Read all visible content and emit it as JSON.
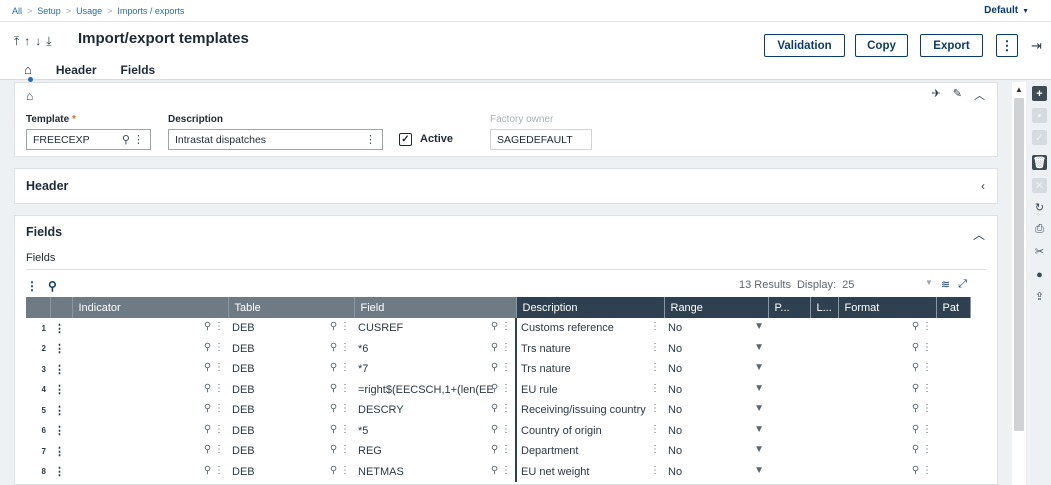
{
  "breadcrumb": [
    "All",
    "Setup",
    "Usage",
    "Imports / exports"
  ],
  "profile": "Default",
  "title": "Import/export templates",
  "nav_arrows": "⤒↑↓⤓",
  "tabs": [
    "Header",
    "Fields"
  ],
  "buttons": {
    "validation": "Validation",
    "copy": "Copy",
    "export": "Export",
    "more": "⋮"
  },
  "form": {
    "template_label": "Template",
    "template_value": "FREECEXP",
    "description_label": "Description",
    "description_value": "Intrastat dispatches",
    "active_label": "Active",
    "active_checked": true,
    "factory_owner_label": "Factory owner",
    "factory_owner_value": "SAGEDEFAULT"
  },
  "sections": {
    "header": "Header",
    "fields": "Fields",
    "fields_sub": "Fields"
  },
  "grid": {
    "results": "13 Results",
    "display_label": "Display:",
    "display_value": "25",
    "columns": [
      "Indicator",
      "Table",
      "Field",
      "Description",
      "Range",
      "P...",
      "L...",
      "Format",
      "Pat"
    ],
    "rows": [
      {
        "n": "1",
        "table": "DEB",
        "field": "CUSREF",
        "description": "Customs reference",
        "range": "No"
      },
      {
        "n": "2",
        "table": "DEB",
        "field": "*6",
        "description": "Trs nature",
        "range": "No"
      },
      {
        "n": "3",
        "table": "DEB",
        "field": "*7",
        "description": "Trs nature",
        "range": "No"
      },
      {
        "n": "4",
        "table": "DEB",
        "field": "=right$(EECSCH,1+(len(EE",
        "description": "EU rule",
        "range": "No"
      },
      {
        "n": "5",
        "table": "DEB",
        "field": "DESCRY",
        "description": "Receiving/issuing country",
        "range": "No"
      },
      {
        "n": "6",
        "table": "DEB",
        "field": "*5",
        "description": "Country of origin",
        "range": "No"
      },
      {
        "n": "7",
        "table": "DEB",
        "field": "REG",
        "description": "Department",
        "range": "No"
      },
      {
        "n": "8",
        "table": "DEB",
        "field": "NETMAS",
        "description": "EU net weight",
        "range": "No"
      }
    ]
  },
  "colors": {
    "accent": "#0b3c6f",
    "header_dark": "#2f4150",
    "header_light": "#6f7b84",
    "required": "#e06c1f"
  }
}
